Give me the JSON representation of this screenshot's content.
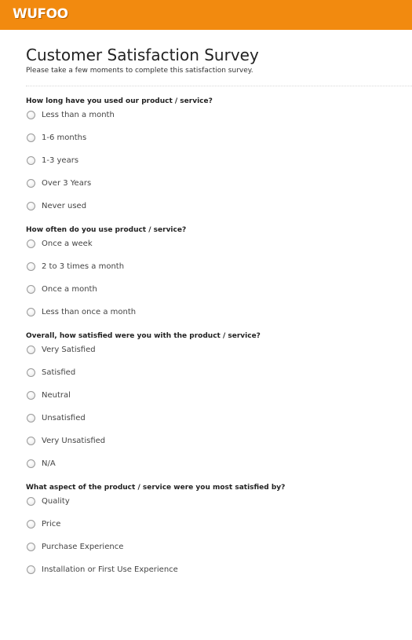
{
  "app": {
    "logo_text": "WUFOO",
    "brand_color": "#f28a0f"
  },
  "form": {
    "title": "Customer Satisfaction Survey",
    "description": "Please take a few moments to complete this satisfaction survey."
  },
  "questions": [
    {
      "label": "How long have you used our product / service?",
      "options": [
        "Less than a month",
        "1-6 months",
        "1-3 years",
        "Over 3 Years",
        "Never used"
      ]
    },
    {
      "label": "How often do you use product / service?",
      "options": [
        "Once a week",
        "2 to 3 times a month",
        "Once a month",
        "Less than once a month"
      ]
    },
    {
      "label": "Overall, how satisfied were you with the product / service?",
      "options": [
        "Very Satisfied",
        "Satisfied",
        "Neutral",
        "Unsatisfied",
        "Very Unsatisfied",
        "N/A"
      ]
    },
    {
      "label": "What aspect of the product / service were you most satisfied by?",
      "options": [
        "Quality",
        "Price",
        "Purchase Experience",
        "Installation or First Use Experience"
      ]
    }
  ]
}
